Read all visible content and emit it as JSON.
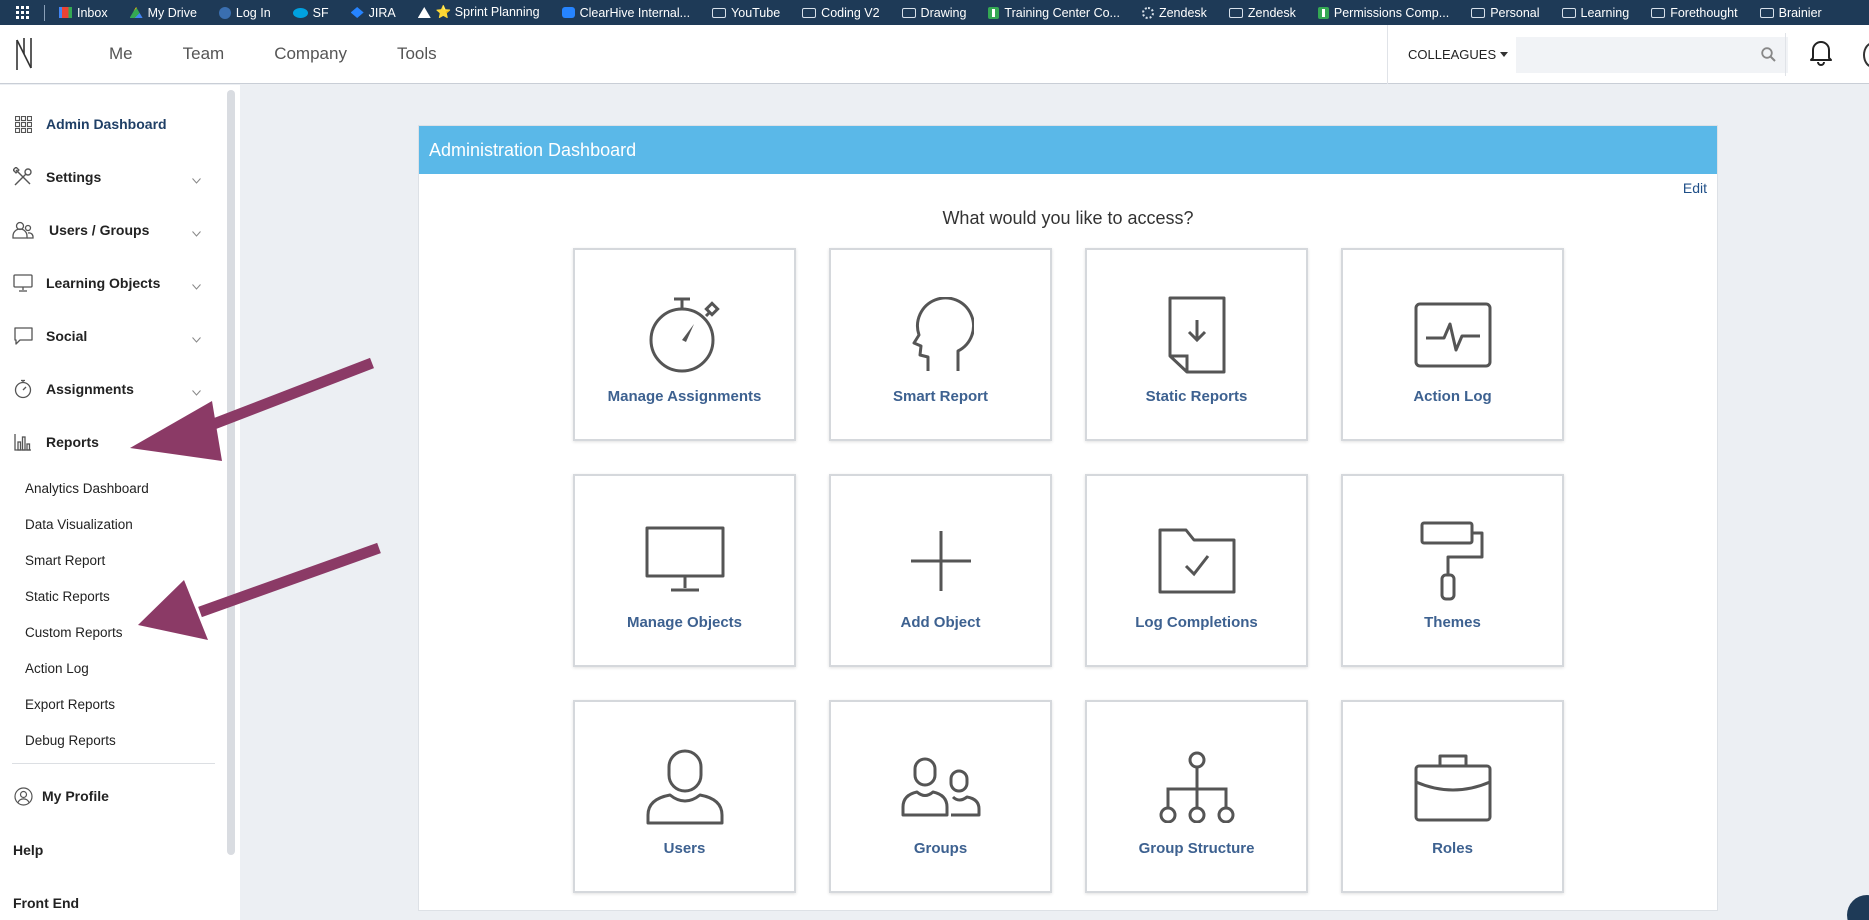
{
  "bookmarks": [
    {
      "label": "Inbox",
      "icon": "gmail-icon"
    },
    {
      "label": "My Drive",
      "icon": "drive-icon"
    },
    {
      "label": "Log In",
      "icon": "login-icon"
    },
    {
      "label": "SF",
      "icon": "salesforce-icon"
    },
    {
      "label": "JIRA",
      "icon": "jira-icon"
    },
    {
      "label": "⭐ Sprint Planning",
      "icon": "sprint-icon"
    },
    {
      "label": "ClearHive Internal...",
      "icon": "confluence-icon"
    },
    {
      "label": "YouTube",
      "icon": "folder-icon"
    },
    {
      "label": "Coding V2",
      "icon": "folder-icon"
    },
    {
      "label": "Drawing",
      "icon": "folder-icon"
    },
    {
      "label": "Training Center Co...",
      "icon": "sheets-icon"
    },
    {
      "label": "Zendesk",
      "icon": "zendesk-icon"
    },
    {
      "label": "Zendesk",
      "icon": "folder-icon"
    },
    {
      "label": "Permissions Comp...",
      "icon": "sheets-icon"
    },
    {
      "label": "Personal",
      "icon": "folder-icon"
    },
    {
      "label": "Learning",
      "icon": "folder-icon"
    },
    {
      "label": "Forethought",
      "icon": "folder-icon"
    },
    {
      "label": "Brainier",
      "icon": "folder-icon"
    }
  ],
  "topnav": {
    "links": [
      "Me",
      "Team",
      "Company",
      "Tools"
    ],
    "colleagues_label": "COLLEAGUES",
    "search_placeholder": ""
  },
  "sidebar": {
    "items": [
      {
        "label": "Admin Dashboard",
        "icon": "grid-icon"
      },
      {
        "label": "Settings",
        "icon": "tools-icon"
      },
      {
        "label": "Users / Groups",
        "icon": "users-icon"
      },
      {
        "label": "Learning Objects",
        "icon": "monitor-icon"
      },
      {
        "label": "Social",
        "icon": "chat-icon"
      },
      {
        "label": "Assignments",
        "icon": "stopwatch-icon"
      },
      {
        "label": "Reports",
        "icon": "bar-chart-icon"
      }
    ],
    "report_sub_items": [
      "Analytics Dashboard",
      "Data Visualization",
      "Smart Report",
      "Static Reports",
      "Custom Reports",
      "Action Log",
      "Export Reports",
      "Debug Reports"
    ],
    "my_profile": "My Profile",
    "help": "Help",
    "front_end": "Front End"
  },
  "panel": {
    "title": "Administration Dashboard",
    "edit": "Edit",
    "question": "What would you like to access?",
    "tiles": [
      {
        "label": "Manage Assignments",
        "icon": "stopwatch-icon"
      },
      {
        "label": "Smart Report",
        "icon": "head-icon"
      },
      {
        "label": "Static Reports",
        "icon": "document-download-icon"
      },
      {
        "label": "Action Log",
        "icon": "activity-monitor-icon"
      },
      {
        "label": "Manage Objects",
        "icon": "monitor-icon"
      },
      {
        "label": "Add Object",
        "icon": "plus-icon"
      },
      {
        "label": "Log Completions",
        "icon": "folder-check-icon"
      },
      {
        "label": "Themes",
        "icon": "paint-roller-icon"
      },
      {
        "label": "Users",
        "icon": "user-icon"
      },
      {
        "label": "Groups",
        "icon": "group-icon"
      },
      {
        "label": "Group Structure",
        "icon": "hierarchy-icon"
      },
      {
        "label": "Roles",
        "icon": "briefcase-icon"
      }
    ]
  },
  "colors": {
    "bookmarks_bar": "#1e3a57",
    "panel_header": "#5ab8e8",
    "tile_label": "#3d6190",
    "annotation_arrow": "#8b3a66",
    "page_background": "#eceff3"
  }
}
